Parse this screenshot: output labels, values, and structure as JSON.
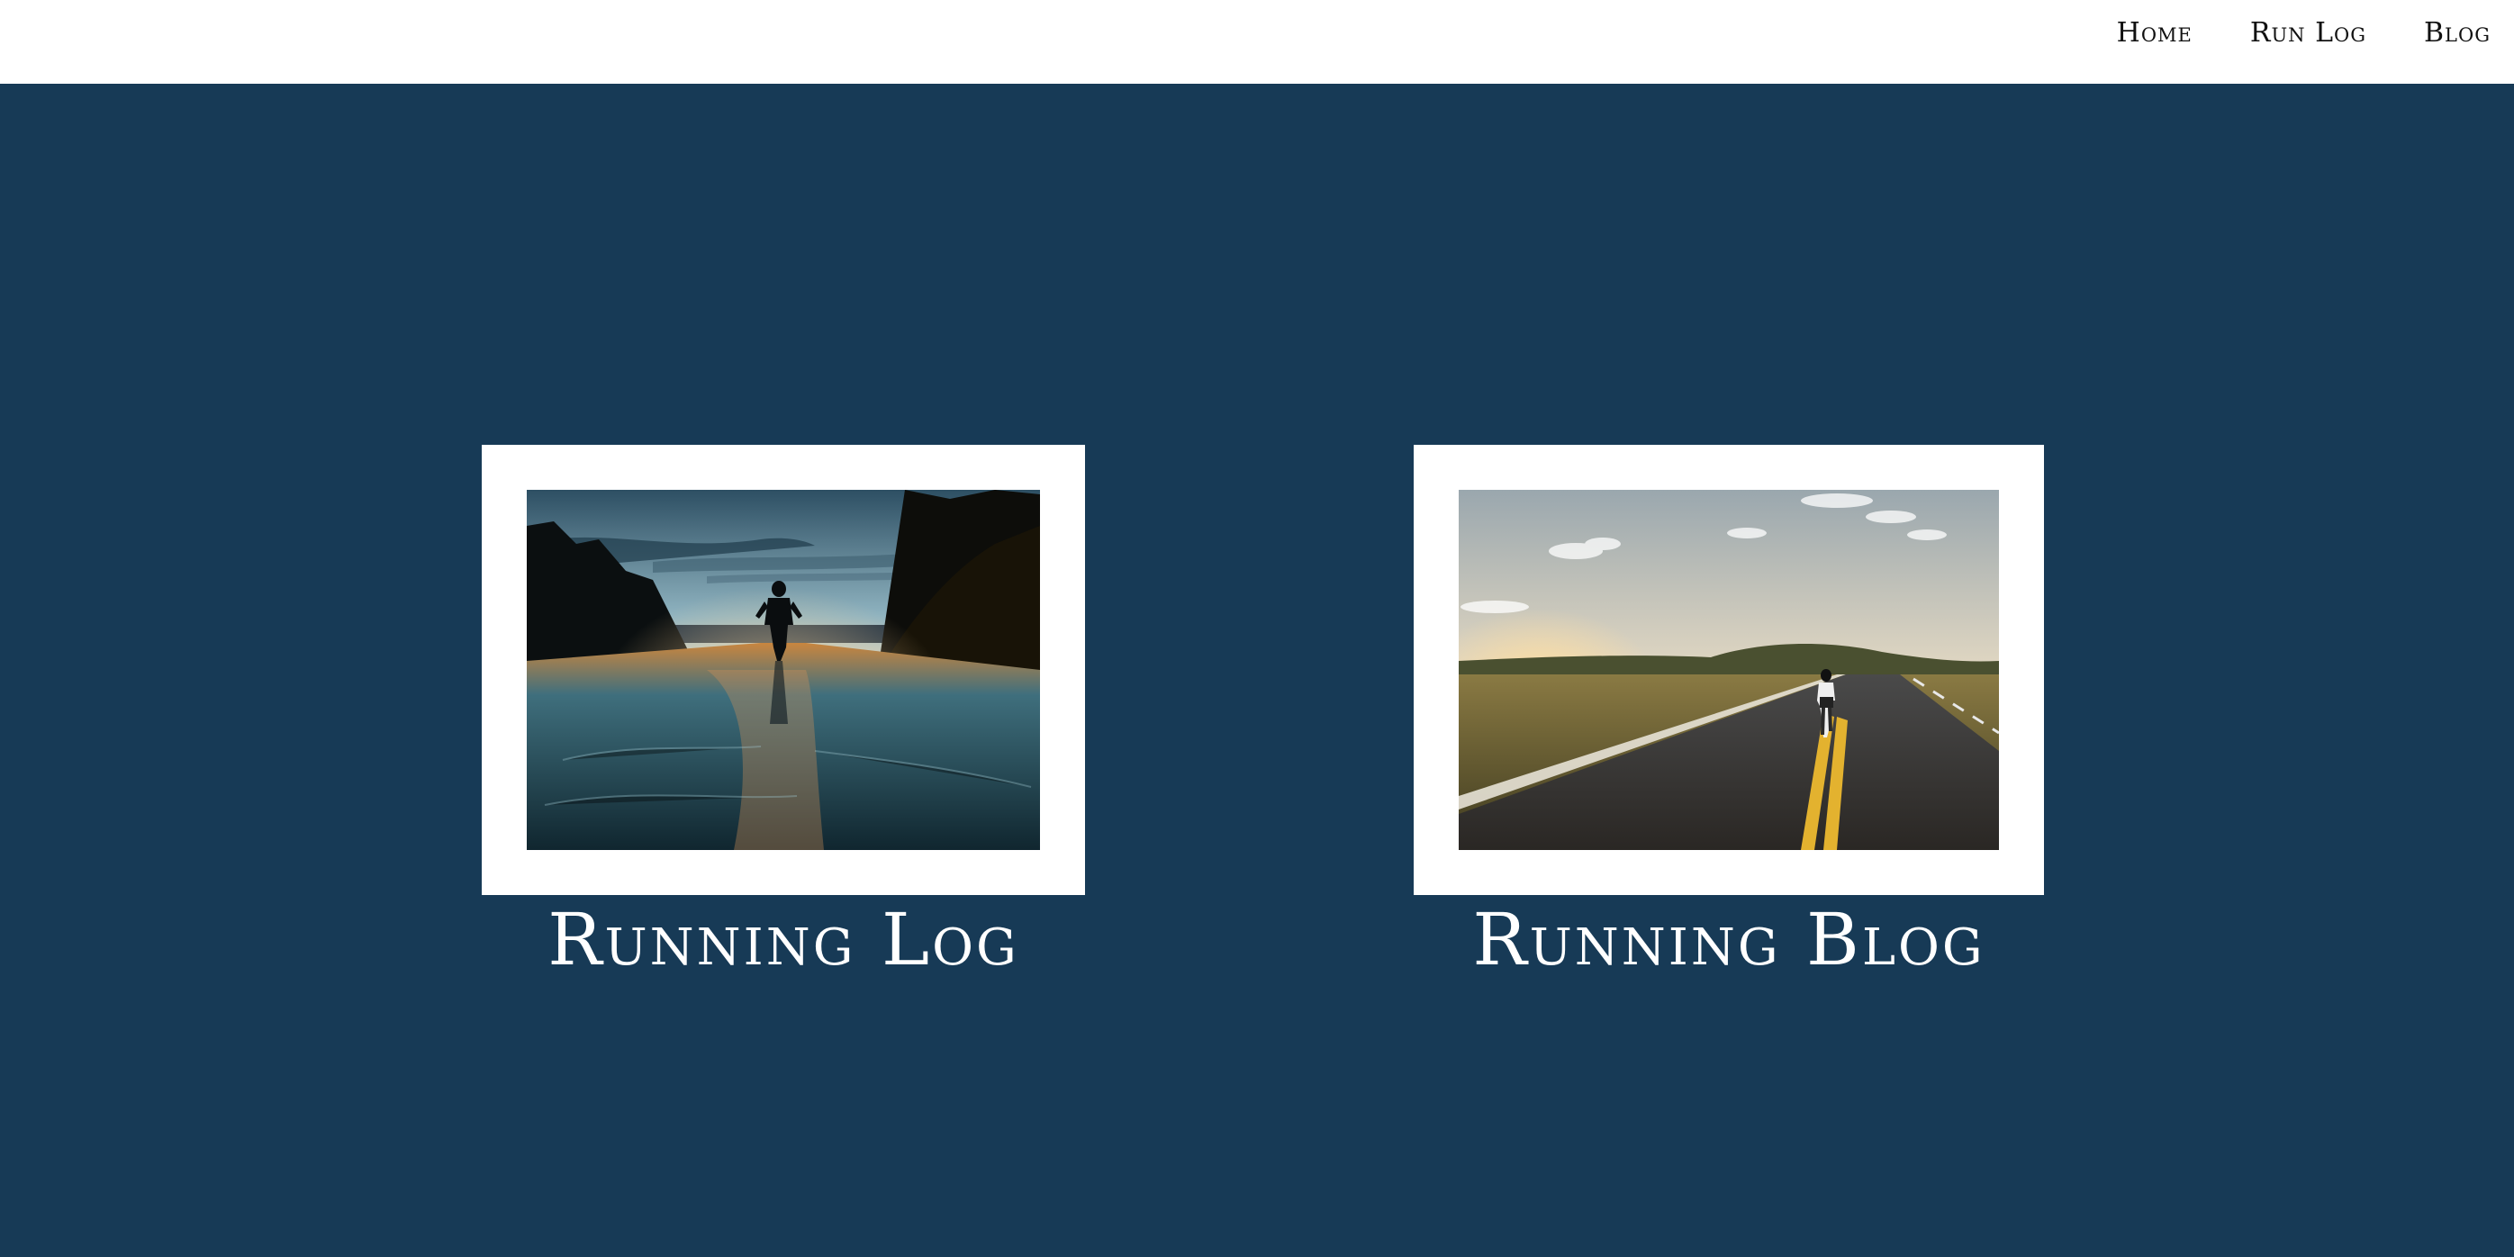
{
  "nav": {
    "items": [
      {
        "label": "Home"
      },
      {
        "label": "Run Log"
      },
      {
        "label": "Blog"
      }
    ]
  },
  "cards": [
    {
      "title": "Running Log"
    },
    {
      "title": "Running Blog"
    }
  ],
  "colors": {
    "background": "#173a56",
    "nav_background": "#ffffff",
    "frame": "#ffffff",
    "title_text": "#ffffff"
  }
}
